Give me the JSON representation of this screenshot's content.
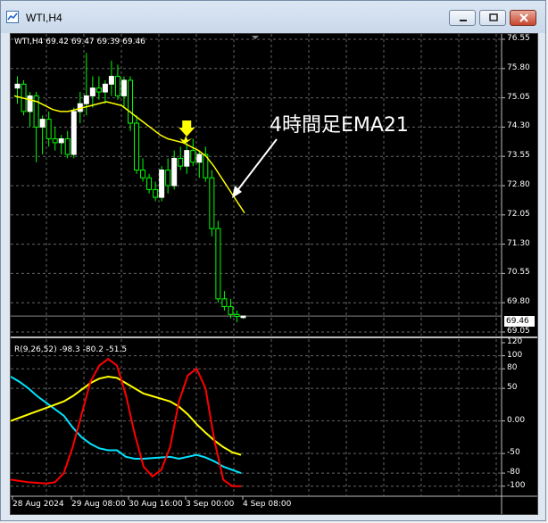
{
  "window": {
    "title": "WTI,H4",
    "buttons": [
      "minimize",
      "maximize",
      "close"
    ]
  },
  "price_panel": {
    "header": "WTI,H4  69.42 69.47 69.39 69.46",
    "current_price": "69.46",
    "annotation": "4時間足EMA21",
    "y_labels": [
      "76.55",
      "75.80",
      "75.05",
      "74.30",
      "73.55",
      "72.80",
      "72.05",
      "71.30",
      "70.55",
      "69.80",
      "69.05"
    ],
    "colors": {
      "bull": "#ffffff",
      "bear": "#00ff00",
      "ema": "#ffff00",
      "arrow_marker": "#ffff00"
    }
  },
  "indicator_panel": {
    "header": "R(9,26,52) -98.3 -80.2 -51.5",
    "y_labels": [
      "120",
      "100",
      "80",
      "50",
      "0.00",
      "-50",
      "-80",
      "-100"
    ],
    "colors": {
      "fast": "#ff0000",
      "mid": "#ffff00",
      "slow": "#00e5ff"
    }
  },
  "x_labels": [
    "28 Aug 2024",
    "29 Aug 08:00",
    "30 Aug 16:00",
    "3 Sep 00:00",
    "4 Sep 08:00"
  ],
  "chart_data": {
    "type": "candlestick",
    "title": "WTI,H4",
    "price_range": [
      69.05,
      76.55
    ],
    "candles": [
      {
        "o": 75.3,
        "h": 75.6,
        "l": 74.9,
        "c": 75.4
      },
      {
        "o": 75.4,
        "h": 75.5,
        "l": 74.6,
        "c": 74.7
      },
      {
        "o": 74.7,
        "h": 75.2,
        "l": 74.3,
        "c": 75.1
      },
      {
        "o": 75.1,
        "h": 75.2,
        "l": 73.4,
        "c": 74.3
      },
      {
        "o": 74.3,
        "h": 74.6,
        "l": 73.6,
        "c": 74.5
      },
      {
        "o": 74.5,
        "h": 74.7,
        "l": 73.8,
        "c": 74.0
      },
      {
        "o": 74.0,
        "h": 74.3,
        "l": 73.7,
        "c": 73.9
      },
      {
        "o": 73.9,
        "h": 74.1,
        "l": 73.6,
        "c": 74.0
      },
      {
        "o": 74.0,
        "h": 74.2,
        "l": 73.5,
        "c": 73.6
      },
      {
        "o": 73.6,
        "h": 74.8,
        "l": 73.5,
        "c": 74.7
      },
      {
        "o": 74.7,
        "h": 75.2,
        "l": 74.4,
        "c": 74.9
      },
      {
        "o": 74.9,
        "h": 76.2,
        "l": 74.6,
        "c": 75.1
      },
      {
        "o": 75.1,
        "h": 75.6,
        "l": 74.8,
        "c": 75.3
      },
      {
        "o": 75.3,
        "h": 75.6,
        "l": 75.0,
        "c": 75.2
      },
      {
        "o": 75.2,
        "h": 75.5,
        "l": 74.9,
        "c": 75.4
      },
      {
        "o": 75.4,
        "h": 76.0,
        "l": 75.1,
        "c": 75.6
      },
      {
        "o": 75.6,
        "h": 75.9,
        "l": 75.0,
        "c": 75.1
      },
      {
        "o": 75.1,
        "h": 75.6,
        "l": 74.8,
        "c": 75.5
      },
      {
        "o": 75.5,
        "h": 75.6,
        "l": 74.2,
        "c": 74.4
      },
      {
        "o": 74.4,
        "h": 74.6,
        "l": 73.1,
        "c": 73.2
      },
      {
        "o": 73.2,
        "h": 73.5,
        "l": 72.9,
        "c": 73.0
      },
      {
        "o": 73.0,
        "h": 73.1,
        "l": 72.6,
        "c": 72.7
      },
      {
        "o": 72.7,
        "h": 72.9,
        "l": 72.4,
        "c": 72.5
      },
      {
        "o": 72.5,
        "h": 73.3,
        "l": 72.4,
        "c": 73.2
      },
      {
        "o": 73.2,
        "h": 73.5,
        "l": 72.6,
        "c": 72.8
      },
      {
        "o": 72.8,
        "h": 73.7,
        "l": 72.7,
        "c": 73.5
      },
      {
        "o": 73.5,
        "h": 73.8,
        "l": 73.2,
        "c": 73.3
      },
      {
        "o": 73.3,
        "h": 73.9,
        "l": 73.1,
        "c": 73.7
      },
      {
        "o": 73.7,
        "h": 74.0,
        "l": 73.3,
        "c": 73.4
      },
      {
        "o": 73.4,
        "h": 73.7,
        "l": 73.0,
        "c": 73.6
      },
      {
        "o": 73.6,
        "h": 73.8,
        "l": 72.9,
        "c": 73.0
      },
      {
        "o": 73.0,
        "h": 73.2,
        "l": 71.5,
        "c": 71.7
      },
      {
        "o": 71.7,
        "h": 71.9,
        "l": 69.8,
        "c": 69.9
      },
      {
        "o": 69.9,
        "h": 70.1,
        "l": 69.6,
        "c": 69.7
      },
      {
        "o": 69.7,
        "h": 69.9,
        "l": 69.4,
        "c": 69.5
      },
      {
        "o": 69.5,
        "h": 69.6,
        "l": 69.3,
        "c": 69.45
      },
      {
        "o": 69.42,
        "h": 69.47,
        "l": 69.39,
        "c": 69.46
      }
    ],
    "ema21": [
      75.1,
      75.05,
      75.0,
      74.95,
      74.85,
      74.75,
      74.7,
      74.7,
      74.75,
      74.8,
      74.85,
      74.9,
      74.95,
      74.9,
      74.85,
      74.7,
      74.55,
      74.4,
      74.25,
      74.1,
      74.0,
      73.95,
      73.9,
      73.8,
      73.7,
      73.55,
      73.3,
      73.0,
      72.7,
      72.4,
      72.1
    ],
    "signal_index": 27,
    "indicator": {
      "name": "R(9,26,52)",
      "range": [
        -110,
        120
      ],
      "fast": [
        -90,
        -92,
        -94,
        -95,
        -96,
        -94,
        -80,
        -40,
        10,
        60,
        85,
        95,
        85,
        40,
        -20,
        -70,
        -85,
        -75,
        -40,
        30,
        70,
        80,
        50,
        -30,
        -90,
        -100,
        -100
      ],
      "mid": [
        0,
        5,
        10,
        15,
        20,
        25,
        30,
        38,
        48,
        58,
        65,
        68,
        66,
        58,
        50,
        42,
        38,
        34,
        30,
        22,
        10,
        -5,
        -18,
        -30,
        -40,
        -48,
        -52
      ],
      "slow": [
        68,
        60,
        50,
        38,
        28,
        18,
        8,
        -10,
        -25,
        -35,
        -42,
        -45,
        -45,
        -55,
        -58,
        -58,
        -57,
        -56,
        -55,
        -58,
        -55,
        -52,
        -56,
        -62,
        -70,
        -75,
        -80
      ]
    }
  }
}
